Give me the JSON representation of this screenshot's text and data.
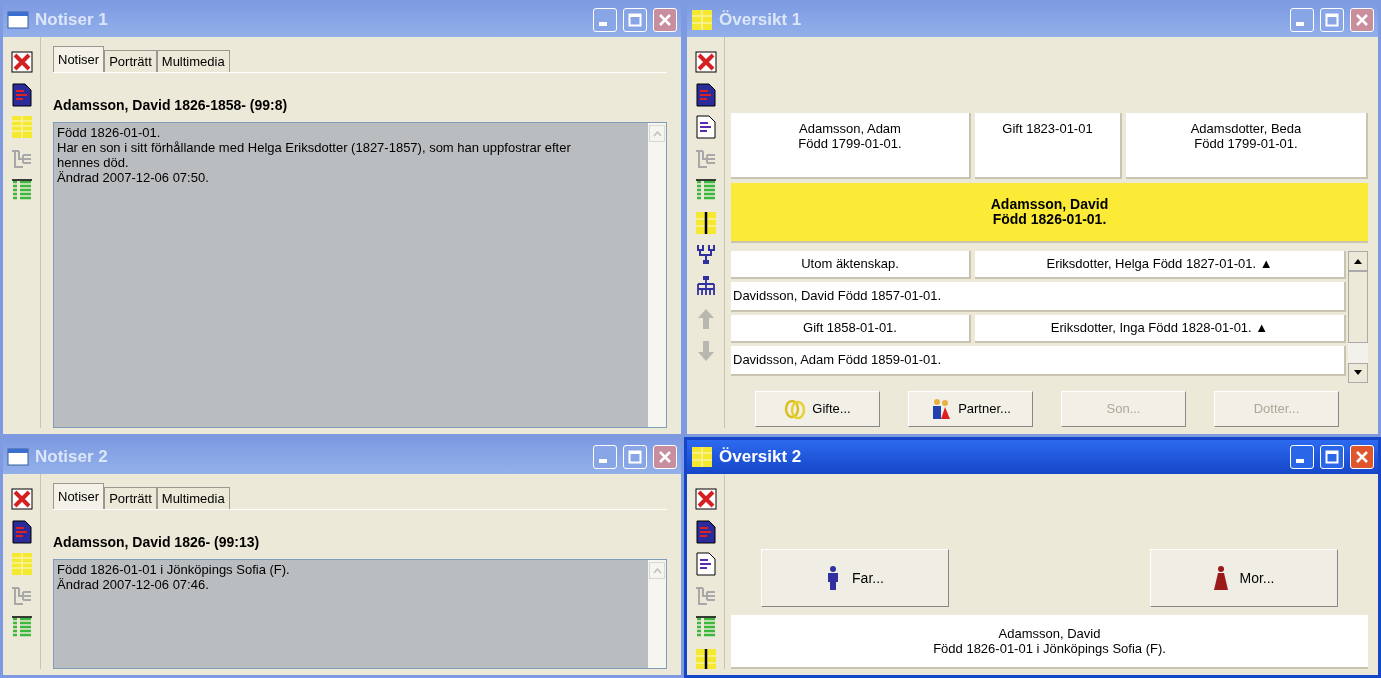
{
  "windows": [
    {
      "kind": "notes",
      "title": "Notiser 1",
      "active": false,
      "tabs": [
        {
          "label": "Notiser",
          "selected": true
        },
        {
          "label": "Porträtt",
          "selected": false
        },
        {
          "label": "Multimedia",
          "selected": false
        }
      ],
      "heading": "Adamsson, David 1826-1858- (99:8)",
      "notes": [
        "Född 1826-01-01.",
        "Har en son i sitt förhållande med Helga Eriksdotter (1827-1857), som han uppfostrar efter hennes död.",
        "Ändrad 2007-12-06 07:50."
      ]
    },
    {
      "kind": "overview",
      "title": "Översikt 1",
      "active": false,
      "parents": {
        "father": [
          "Adamsson, Adam",
          "Född 1799-01-01."
        ],
        "marriage": "Gift 1823-01-01",
        "mother": [
          "Adamsdotter, Beda",
          "Född 1799-01-01."
        ]
      },
      "focus": {
        "highlighted": true,
        "lines": [
          "Adamsson, David",
          "Född 1826-01-01."
        ]
      },
      "families": [
        {
          "relation": "Utom äktenskap.",
          "partner": "Eriksdotter, Helga Född 1827-01-01. ▲",
          "children": [
            "Davidsson, David Född 1857-01-01."
          ]
        },
        {
          "relation": "Gift 1858-01-01.",
          "partner": "Eriksdotter, Inga Född 1828-01-01. ▲",
          "children": [
            "Davidsson, Adam Född 1859-01-01."
          ]
        }
      ],
      "buttons": [
        {
          "kind": "rings",
          "label": "Gifte...",
          "disabled": false
        },
        {
          "kind": "couple",
          "label": "Partner...",
          "disabled": false
        },
        {
          "kind": "plain",
          "label": "Son...",
          "disabled": true
        },
        {
          "kind": "plain",
          "label": "Dotter...",
          "disabled": true
        }
      ]
    },
    {
      "kind": "notes",
      "title": "Notiser 2",
      "active": false,
      "tabs": [
        {
          "label": "Notiser",
          "selected": true
        },
        {
          "label": "Porträtt",
          "selected": false
        },
        {
          "label": "Multimedia",
          "selected": false
        }
      ],
      "heading": "Adamsson, David 1826- (99:13)",
      "notes": [
        "Född 1826-01-01 i Jönköpings Sofia (F).",
        "Ändrad 2007-12-06 07:46."
      ]
    },
    {
      "kind": "parents",
      "title": "Översikt 2",
      "active": true,
      "buttons": [
        {
          "kind": "man",
          "label": "Far..."
        },
        {
          "kind": "woman",
          "label": "Mor..."
        }
      ],
      "focus": {
        "highlighted": false,
        "lines": [
          "Adamsson, David",
          "Född 1826-01-01 i Jönköpings Sofia (F)."
        ]
      }
    }
  ]
}
